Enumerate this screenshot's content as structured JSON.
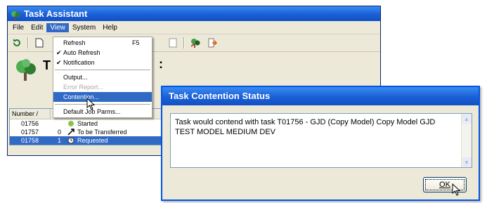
{
  "main_window": {
    "title": "Task Assistant",
    "menu": [
      "File",
      "Edit",
      "View",
      "System",
      "Help"
    ],
    "big_label": "T",
    "big_colon": ":"
  },
  "view_menu": {
    "items": [
      {
        "label": "Refresh",
        "shortcut": "F5"
      },
      {
        "label": "Auto Refresh",
        "checked": "✔"
      },
      {
        "label": "Notification",
        "checked": "✔"
      },
      {
        "label": "Output..."
      },
      {
        "label": "Error Report..."
      },
      {
        "label": "Contention..."
      },
      {
        "label": "Default Job Parms..."
      }
    ]
  },
  "task_list": {
    "columns": [
      "Number /"
    ],
    "rows": [
      {
        "number": "01756",
        "col2": "",
        "status": "Started"
      },
      {
        "number": "01757",
        "col2": "0",
        "status": "To be Transferred"
      },
      {
        "number": "01758",
        "col2": "1",
        "status": "Requested"
      }
    ]
  },
  "dialog": {
    "title": "Task Contention Status",
    "message": "Task would contend with task T01756 - GJD (Copy Model) Copy Model GJD TEST MODEL MEDIUM DEV",
    "ok_label": "OK"
  },
  "colors": {
    "titlebar": "#1a5fd6",
    "selection": "#316ac5",
    "window_face": "#ece9d8"
  }
}
